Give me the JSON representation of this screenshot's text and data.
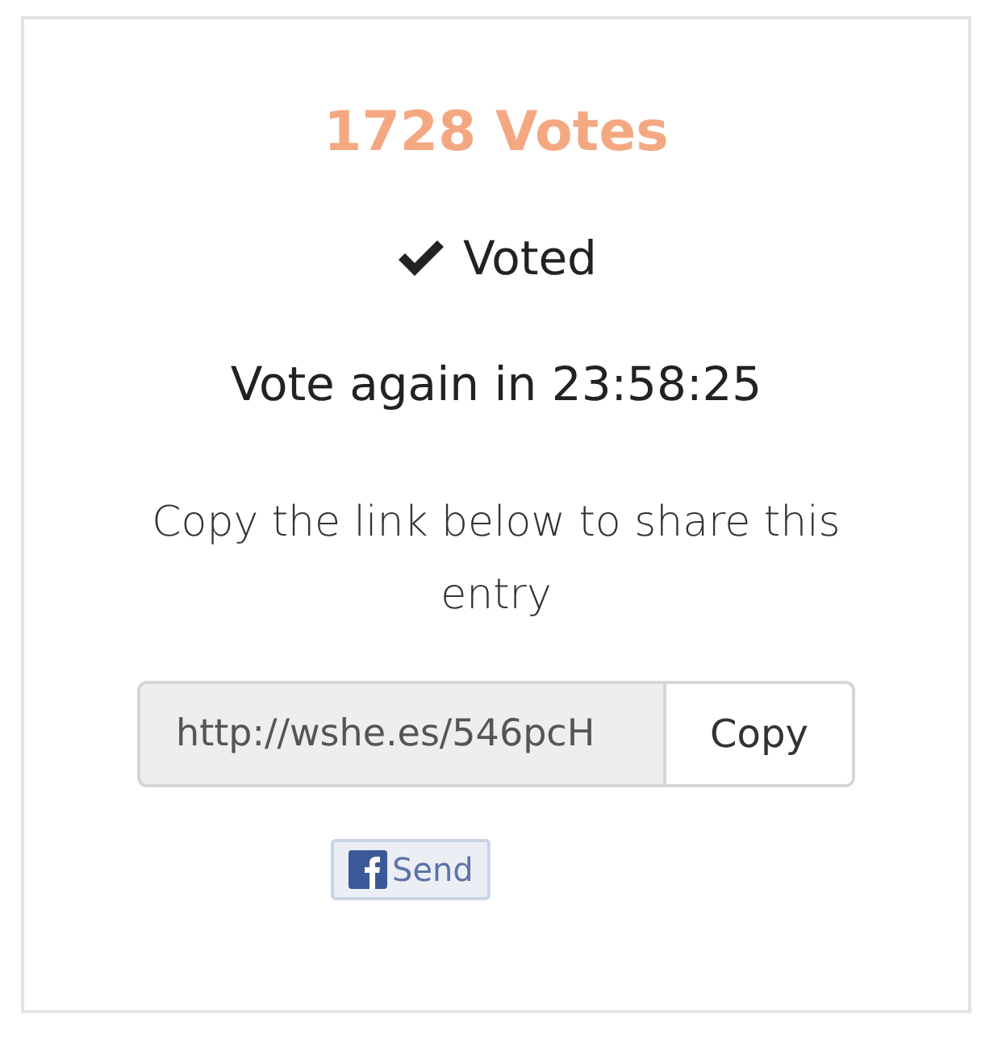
{
  "votes": "1728 Votes",
  "status": {
    "voted": true,
    "label": "Voted"
  },
  "countdown": "Vote again in 23:58:25",
  "share_text": "Copy the link below to share this entry",
  "link": {
    "value": "http://wshe.es/546pcH",
    "button": "Copy"
  },
  "send_button": "Send"
}
